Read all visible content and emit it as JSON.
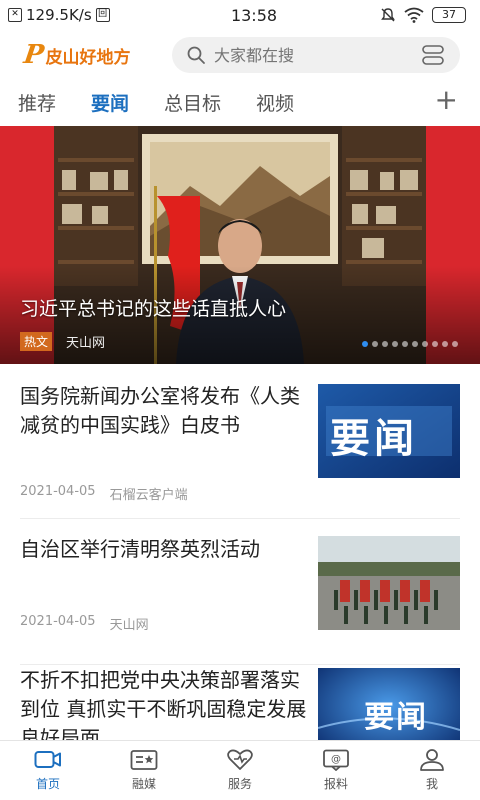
{
  "status_bar": {
    "network_speed": "129.5K/s",
    "time": "13:58",
    "battery": "37"
  },
  "header": {
    "logo_text": "皮山好地方",
    "search_placeholder": "大家都在搜"
  },
  "tabs": [
    {
      "label": "推荐",
      "active": false
    },
    {
      "label": "要闻",
      "active": true
    },
    {
      "label": "总目标",
      "active": false
    },
    {
      "label": "视频",
      "active": false
    }
  ],
  "banner": {
    "title": "习近平总书记的这些话直抵人心",
    "tag": "热文",
    "source": "天山网",
    "slide_count": 10,
    "active_slide": 0
  },
  "news": [
    {
      "title": "国务院新闻办公室将发布《人类减贫的中国实践》白皮书",
      "date": "2021-04-05",
      "source": "石榴云客户端",
      "thumb_text": "要闻"
    },
    {
      "title": "自治区举行清明祭英烈活动",
      "date": "2021-04-05",
      "source": "天山网",
      "thumb_text": ""
    },
    {
      "title": "不折不扣把党中央决策部署落实到位 真抓实干不断巩固稳定发展良好局面",
      "date": "",
      "source": "",
      "thumb_text": "要闻"
    }
  ],
  "bottom_nav": [
    {
      "label": "首页",
      "icon": "video-icon",
      "active": true
    },
    {
      "label": "融媒",
      "icon": "media-icon",
      "active": false
    },
    {
      "label": "服务",
      "icon": "heart-icon",
      "active": false
    },
    {
      "label": "报料",
      "icon": "report-icon",
      "active": false
    },
    {
      "label": "我",
      "icon": "user-icon",
      "active": false
    }
  ],
  "colors": {
    "accent": "#1c6fbf",
    "logo": "#e8750f",
    "banner_red": "#e0262a"
  }
}
